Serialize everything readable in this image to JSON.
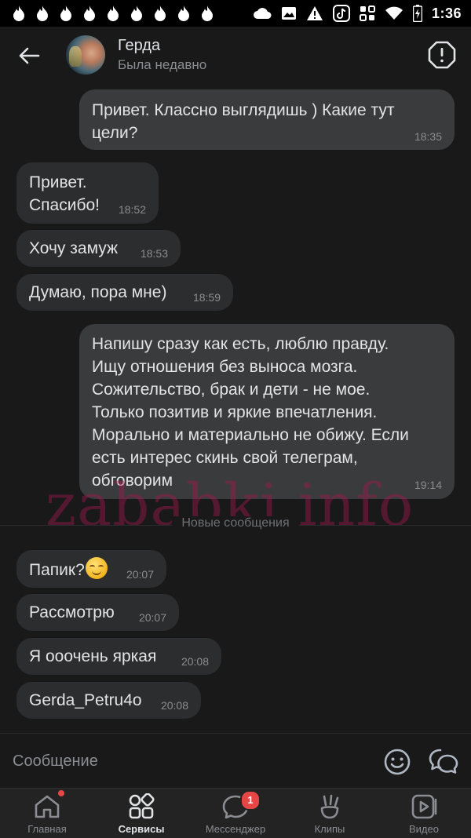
{
  "status_bar": {
    "time": "1:36",
    "notification_icons": [
      "flame-icon",
      "flame-icon",
      "flame-icon",
      "flame-icon",
      "flame-icon",
      "flame-icon",
      "flame-icon",
      "flame-icon",
      "flame-icon"
    ],
    "system_icons": [
      "cloud-icon",
      "image-icon",
      "warning-icon",
      "tiktok-icon",
      "wallpaper-icon",
      "wifi-icon",
      "battery-charging-icon"
    ]
  },
  "header": {
    "name": "Герда",
    "status": "Была недавно"
  },
  "messages": [
    {
      "direction": "out",
      "text": "Привет. Классно выглядишь ) Какие тут\nцели?",
      "time": "18:35"
    },
    {
      "direction": "in",
      "text": "Привет.\nСпасибо!",
      "time": "18:52"
    },
    {
      "direction": "in",
      "text": "Хочу замуж",
      "time": "18:53"
    },
    {
      "direction": "in",
      "text": "Думаю, пора мне)",
      "time": "18:59"
    },
    {
      "direction": "out",
      "text": "Напишу сразу как есть, люблю правду.\nИщу отношения без выноса мозга.\nСожительство, брак и дети - не мое.\nТолько позитив и яркие впечатления.\nМорально и материально не обижу. Если\nесть интерес скинь свой телеграм,\nобговорим",
      "time": "19:14"
    },
    {
      "direction": "in",
      "text": "Папик?",
      "emoji": "smiling-face-emoji",
      "time": "20:07"
    },
    {
      "direction": "in",
      "text": "Рассмотрю",
      "time": "20:07"
    },
    {
      "direction": "in",
      "text": "Я ооочень яркая",
      "time": "20:08"
    },
    {
      "direction": "in",
      "text": "Gerda_Petru4o",
      "time": "20:08"
    }
  ],
  "divider": {
    "label": "Новые сообщения"
  },
  "watermark": "zababki.info",
  "composer": {
    "placeholder": "Сообщение"
  },
  "nav": {
    "items": [
      {
        "label": "Главная",
        "icon": "home-icon",
        "has_dot": true
      },
      {
        "label": "Сервисы",
        "icon": "services-icon",
        "active": true
      },
      {
        "label": "Мессенджер",
        "icon": "messenger-icon",
        "badge": "1"
      },
      {
        "label": "Клипы",
        "icon": "clips-icon"
      },
      {
        "label": "Видео",
        "icon": "video-icon"
      }
    ]
  },
  "colors": {
    "background": "#19191a",
    "bubble_in": "#2c2d2e",
    "bubble_out": "#3a3b3c",
    "text": "#e1e3e6",
    "secondary_text": "#8a8d91",
    "badge": "#e64646",
    "watermark": "#a8184e"
  }
}
